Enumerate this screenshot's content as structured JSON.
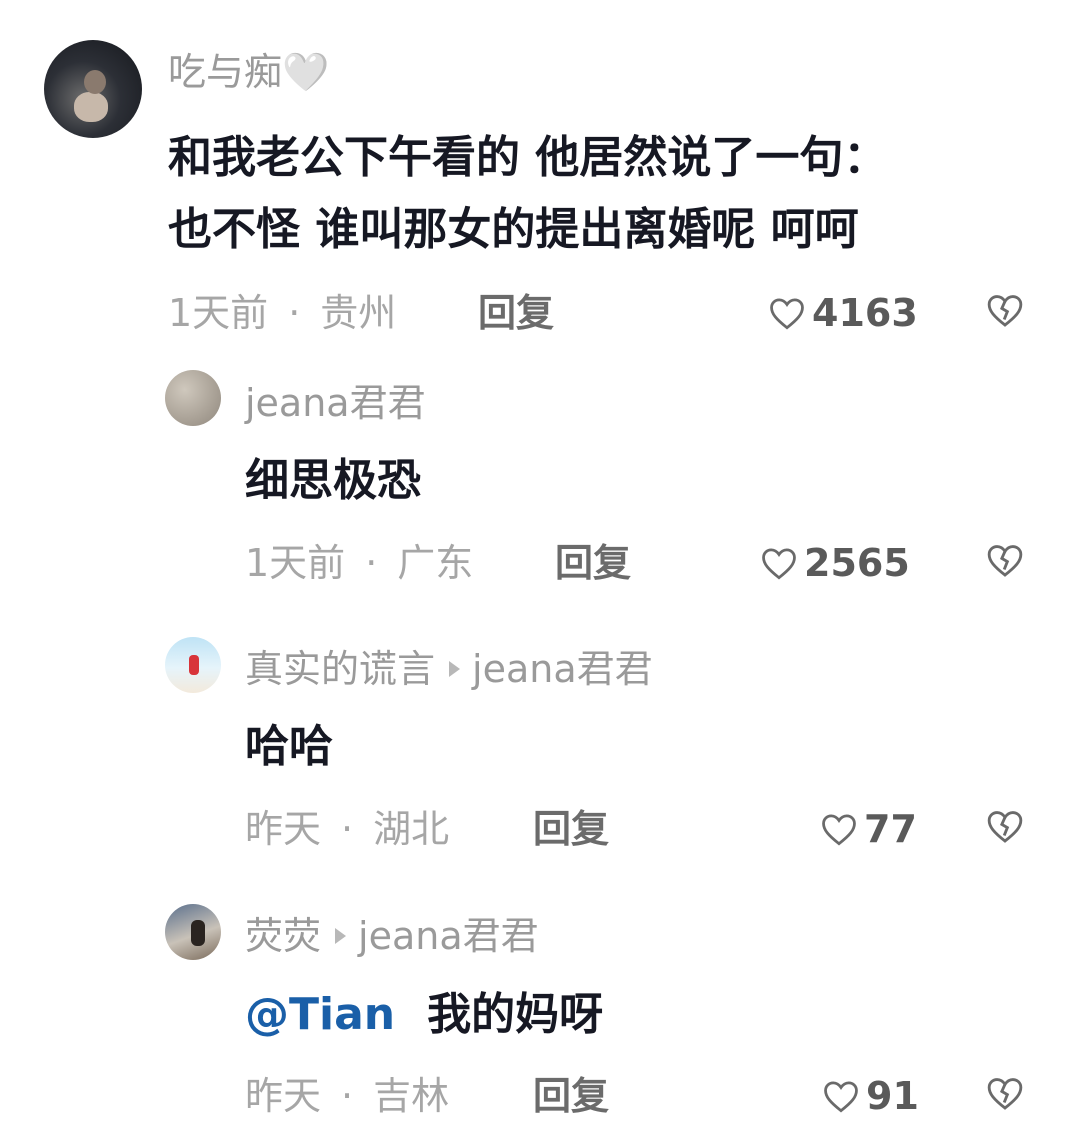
{
  "comments": [
    {
      "author": "吃与痴🤍",
      "text_lines": [
        "和我老公下午看的 他居然说了一句：",
        "也不怪 谁叫那女的提出离婚呢 呵呵"
      ],
      "time": "1天前",
      "location": "贵州",
      "reply_label": "回复",
      "likes": "4163"
    },
    {
      "author": "jeana君君",
      "text": "细思极恐",
      "time": "1天前",
      "location": "广东",
      "reply_label": "回复",
      "likes": "2565"
    },
    {
      "author": "真实的谎言",
      "reply_to": "jeana君君",
      "text": "哈哈",
      "time": "昨天",
      "location": "湖北",
      "reply_label": "回复",
      "likes": "77"
    },
    {
      "author": "荧荧",
      "reply_to": "jeana君君",
      "mention": "@Tian",
      "text": "我的妈呀",
      "time": "昨天",
      "location": "吉林",
      "reply_label": "回复",
      "likes": "91"
    }
  ],
  "separator": "·",
  "icons": {
    "like": "heart-outline-icon",
    "dislike": "broken-heart-icon",
    "reply_arrow": "triangle-right-icon"
  },
  "colors": {
    "text": "#161823",
    "meta": "#a6a6a6",
    "mention": "#1a5fa8"
  }
}
